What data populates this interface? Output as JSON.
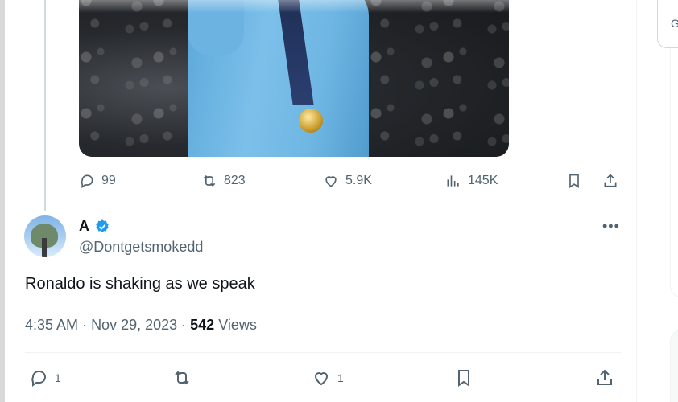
{
  "quoted_tweet": {
    "media_alt": "Player in light blue jersey with medal",
    "actions": {
      "replies": "99",
      "reposts": "823",
      "likes": "5.9K",
      "views": "145K"
    }
  },
  "reply_tweet": {
    "display_name": "A",
    "verified": true,
    "handle": "@Dontgetsmokedd",
    "text": "Ronaldo is shaking as we speak",
    "time": "4:35 AM",
    "date": "Nov 29, 2023",
    "views_count": "542",
    "views_label": "Views",
    "actions": {
      "replies": "1",
      "likes": "1"
    }
  },
  "sidebar": {
    "partial_letter": "G"
  },
  "colors": {
    "verified": "#1d9bf0",
    "muted": "#536471",
    "text": "#0f1419"
  }
}
